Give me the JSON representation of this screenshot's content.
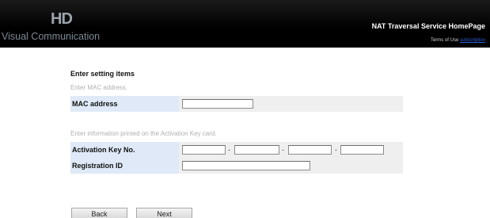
{
  "header": {
    "logo_mark": "HD",
    "logo_sub": "Visual Communication",
    "site_title": "NAT Traversal Service HomePage",
    "terms_link": "Terms of Use",
    "subscription_link": "subscription"
  },
  "form": {
    "heading": "Enter setting items",
    "mac_hint": "Enter MAC address.",
    "mac_label": "MAC address",
    "mac_value": "",
    "card_hint": "Enter information printed on the Activation Key card.",
    "key_label": "Activation Key No.",
    "key_dash": "-",
    "key_values": [
      "",
      "",
      "",
      ""
    ],
    "reg_label": "Registration ID",
    "reg_value": ""
  },
  "buttons": {
    "back": "Back",
    "next": "Next"
  }
}
